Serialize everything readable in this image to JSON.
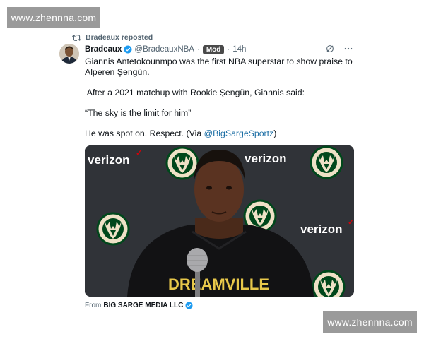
{
  "watermarks": {
    "top": "www.zhennna.com",
    "bottom": "www.zhennna.com"
  },
  "repost": {
    "label": "Bradeaux reposted",
    "icon": "repost-icon"
  },
  "author": {
    "name": "Bradeaux",
    "handle": "@BradeauxNBA",
    "separator": "·",
    "badge": "Mod",
    "time": "14h",
    "verified_color": "#1d9bf0"
  },
  "post": {
    "lines": [
      "Giannis Antetokounmpo was the first NBA superstar to show praise to Alperen Şengün.",
      " After a 2021 matchup with Rookie Şengün, Giannis said:",
      "“The sky is the limit for him”"
    ],
    "last_line_prefix": "He was spot on. Respect. (Via ",
    "mention": "@BigSargeSportz",
    "last_line_suffix": ")"
  },
  "media": {
    "backdrop_texts": [
      "verizon",
      "verizon",
      "verizon"
    ],
    "shirt_text": "DREAMVILLE",
    "logo_text": "MILWAUKEE BUCKS"
  },
  "source": {
    "prefix": "From",
    "name": "BIG SARGE MEDIA LLC"
  },
  "colors": {
    "link": "#1d6fa5",
    "muted": "#536471",
    "bucks_green": "#00471b",
    "bucks_cream": "#eee1c6"
  }
}
